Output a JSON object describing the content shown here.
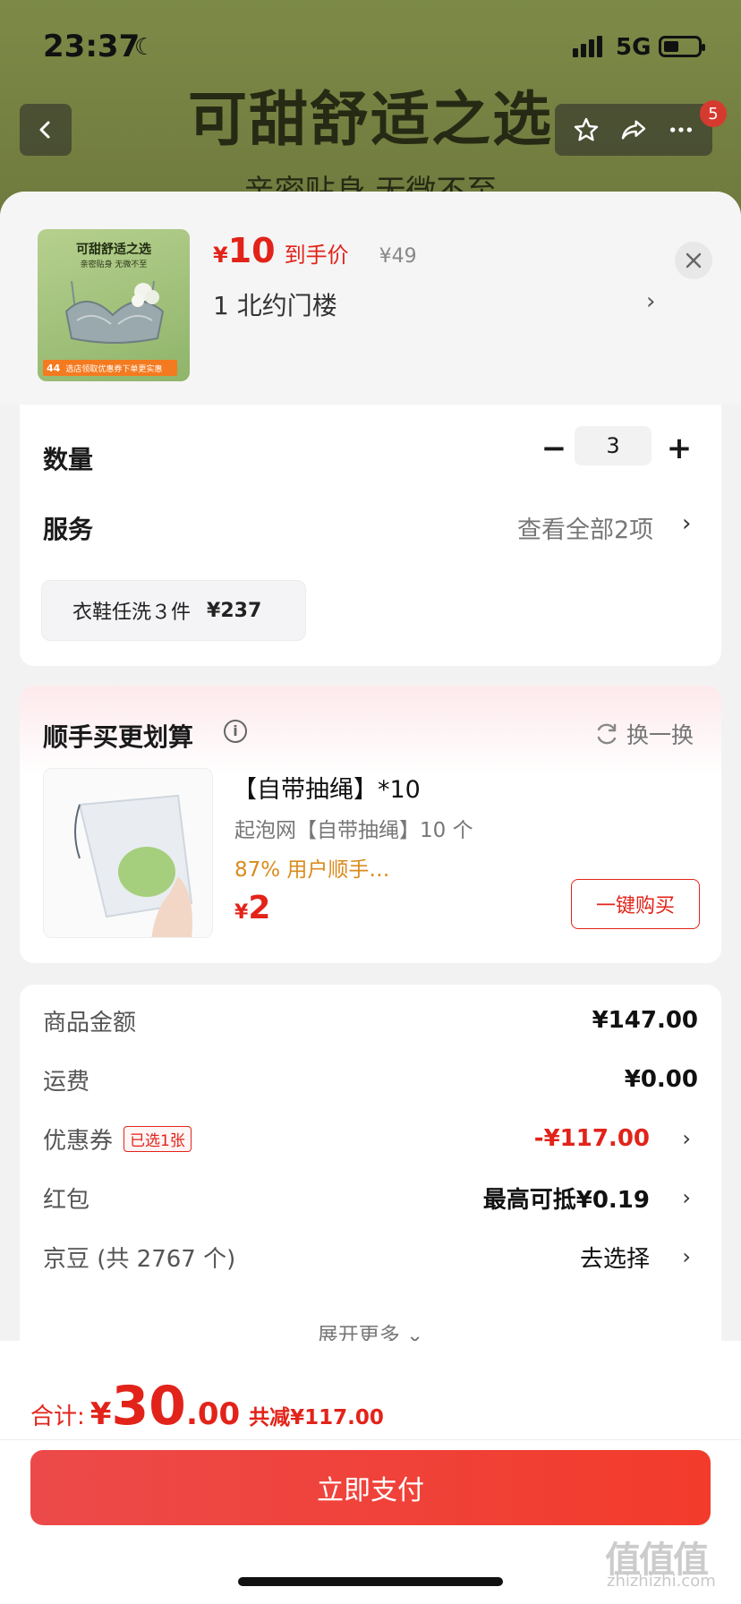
{
  "status_bar": {
    "time": "23:37",
    "network": "5G"
  },
  "background_page": {
    "title": "可甜舒适之选",
    "subtitle": "亲密贴身 无微不至",
    "cart_badge": "5"
  },
  "product": {
    "thumb_title": "可甜舒适之选",
    "thumb_sub": "亲密贴身 无微不至",
    "thumb_price": "44",
    "thumb_strip_text": "选店领取优惠券下单更实惠",
    "price_symbol": "¥",
    "price": "10",
    "price_tag": "到手价",
    "original_price": "¥49",
    "variant": "1  北约门楼"
  },
  "quantity": {
    "label": "数量",
    "value": "3"
  },
  "services": {
    "label": "服务",
    "view_all": "查看全部2项",
    "chip_name": "衣鞋任洗３件",
    "chip_price": "¥237"
  },
  "combo": {
    "title": "顺手买更划算",
    "refresh_label": "换一换",
    "item": {
      "name": "【自带抽绳】*10",
      "desc": "起泡网【自带抽绳】10 个",
      "pct": "87% 用户顺手…",
      "price_symbol": "¥",
      "price": "2",
      "buy_label": "一键购买"
    }
  },
  "fees": {
    "rows": [
      {
        "label": "商品金额",
        "value": "¥147.00"
      },
      {
        "label": "运费",
        "value": "¥0.00"
      },
      {
        "label": "优惠券",
        "tag": "已选1张",
        "value": "-¥117.00"
      },
      {
        "label": "红包",
        "value": "最高可抵¥0.19"
      },
      {
        "label": "京豆 (共 2767 个)",
        "value": "去选择"
      }
    ],
    "expand_label": "展开更多"
  },
  "bottom": {
    "total_label": "合计:",
    "currency": "¥",
    "total_int": "30",
    "total_dec": ".00",
    "reduce_label": "共减¥117.00",
    "pay_label": "立即支付",
    "watermark": "值值值",
    "watermark_sub": "zhizhizhi.com"
  },
  "colors": {
    "accent_red": "#e2231a",
    "pay_gradient_start": "#ec4a4a",
    "pay_gradient_end": "#f33b2b",
    "orange": "#d98b1e"
  }
}
